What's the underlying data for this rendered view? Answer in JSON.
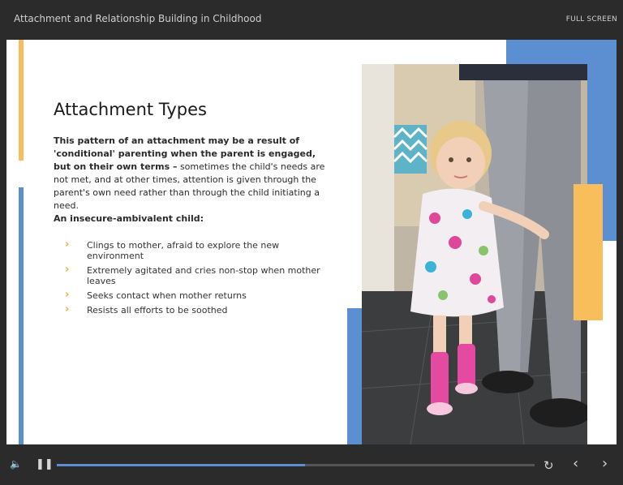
{
  "header": {
    "title": "Attachment and Relationship Building in Childhood",
    "fullscreen_label": "FULL SCREEN"
  },
  "slide": {
    "heading": "Attachment Types",
    "paragraph_bold": "This pattern of an attachment may be a result of 'conditional' parenting when the parent is engaged, but on their own terms –",
    "paragraph_rest": " sometimes the child's needs are not met, and at other times, attention is given through the parent's own need rather than through the child initiating a need.",
    "subheading": "An insecure-ambivalent child:",
    "bullets": [
      "Clings to mother, afraid to explore the new environment",
      "Extremely agitated and cries non-stop when mother leaves",
      "Seeks contact when mother returns",
      "Resists all efforts to be soothed"
    ],
    "colors": {
      "accent_yellow": "#f8be5c",
      "accent_blue": "#5b8fd1",
      "bullet_chevron": "#f3a93a"
    }
  },
  "controls": {
    "volume_icon": "speaker-icon",
    "pause_icon": "pause-icon",
    "replay_icon": "replay-icon",
    "prev_icon": "chevron-left-icon",
    "next_icon": "chevron-right-icon",
    "progress_percent": 52
  }
}
